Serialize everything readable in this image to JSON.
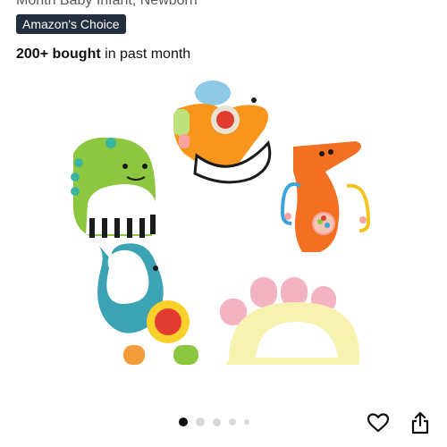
{
  "product": {
    "subtitle": "Month Baby Infant, Newborn",
    "badge": "Amazon's Choice",
    "bought_bold": "200+ bought",
    "bought_rest": " in past month"
  },
  "gallery": {
    "image_alt": "Baby rattle teether toys set of five",
    "dots_total": 5,
    "active_index": 0
  },
  "icons": {
    "favorite": "heart-icon",
    "share": "share-icon"
  },
  "colors": {
    "badge_bg": "#232f3e",
    "dot_active": "#0f1111",
    "dot_inactive": "#d5d9d9"
  }
}
